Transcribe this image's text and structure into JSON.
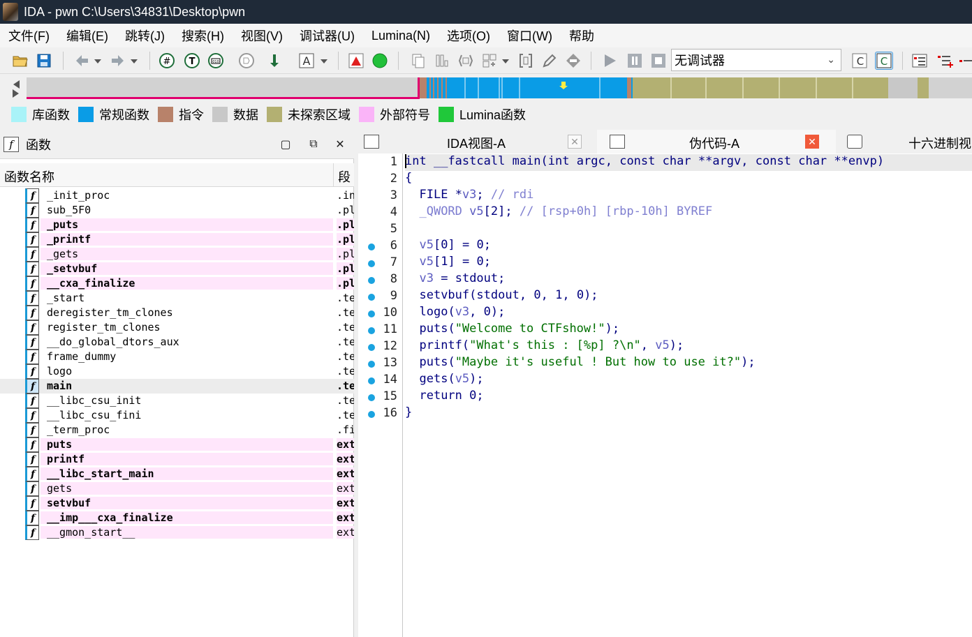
{
  "window": {
    "title": "IDA - pwn C:\\Users\\34831\\Desktop\\pwn"
  },
  "menu": [
    "文件(F)",
    "编辑(E)",
    "跳转(J)",
    "搜索(H)",
    "视图(V)",
    "调试器(U)",
    "Lumina(N)",
    "选项(O)",
    "窗口(W)",
    "帮助"
  ],
  "toolbar": {
    "debugger_select": "无调试器"
  },
  "legend": [
    {
      "label": "库函数",
      "color": "#a9f3f8"
    },
    {
      "label": "常规函数",
      "color": "#0a9ce6"
    },
    {
      "label": "指令",
      "color": "#b8826a"
    },
    {
      "label": "数据",
      "color": "#c8c8c8"
    },
    {
      "label": "未探索区域",
      "color": "#b3b072"
    },
    {
      "label": "外部符号",
      "color": "#fab4f8"
    },
    {
      "label": "Lumina函数",
      "color": "#20c83a"
    }
  ],
  "functions_panel": {
    "title": "函数",
    "col_name": "函数名称",
    "col_segment": "段",
    "rows": [
      {
        "name": "_init_proc",
        "segment": ".init",
        "bold": false,
        "pink": false
      },
      {
        "name": "sub_5F0",
        "segment": ".plt",
        "bold": false,
        "pink": false
      },
      {
        "name": "_puts",
        "segment": ".plt",
        "bold": true,
        "pink": true
      },
      {
        "name": "_printf",
        "segment": ".plt",
        "bold": true,
        "pink": true
      },
      {
        "name": "_gets",
        "segment": ".plt",
        "bold": false,
        "pink": true
      },
      {
        "name": "_setvbuf",
        "segment": ".plt",
        "bold": true,
        "pink": true
      },
      {
        "name": "__cxa_finalize",
        "segment": ".plt",
        "bold": true,
        "pink": true
      },
      {
        "name": "_start",
        "segment": ".text",
        "bold": false,
        "pink": false
      },
      {
        "name": "deregister_tm_clones",
        "segment": ".text",
        "bold": false,
        "pink": false
      },
      {
        "name": "register_tm_clones",
        "segment": ".text",
        "bold": false,
        "pink": false
      },
      {
        "name": "__do_global_dtors_aux",
        "segment": ".text",
        "bold": false,
        "pink": false
      },
      {
        "name": "frame_dummy",
        "segment": ".text",
        "bold": false,
        "pink": false
      },
      {
        "name": "logo",
        "segment": ".text",
        "bold": false,
        "pink": false
      },
      {
        "name": "main",
        "segment": ".text",
        "bold": true,
        "pink": false,
        "selected": true
      },
      {
        "name": "__libc_csu_init",
        "segment": ".text",
        "bold": false,
        "pink": false
      },
      {
        "name": "__libc_csu_fini",
        "segment": ".text",
        "bold": false,
        "pink": false
      },
      {
        "name": "_term_proc",
        "segment": ".fini",
        "bold": false,
        "pink": false
      },
      {
        "name": "puts",
        "segment": "extern",
        "bold": true,
        "pink": true
      },
      {
        "name": "printf",
        "segment": "extern",
        "bold": true,
        "pink": true
      },
      {
        "name": "__libc_start_main",
        "segment": "extern",
        "bold": true,
        "pink": true
      },
      {
        "name": "gets",
        "segment": "extern",
        "bold": false,
        "pink": true
      },
      {
        "name": "setvbuf",
        "segment": "extern",
        "bold": true,
        "pink": true
      },
      {
        "name": "__imp___cxa_finalize",
        "segment": "extern",
        "bold": true,
        "pink": true
      },
      {
        "name": "__gmon_start__",
        "segment": "extern",
        "bold": false,
        "pink": true
      }
    ]
  },
  "tabs": [
    {
      "label": "IDA视图-A"
    },
    {
      "label": "伪代码-A"
    },
    {
      "label": "十六进制视"
    }
  ],
  "code": {
    "lines": [
      {
        "n": "1",
        "dot": false,
        "text": "int __fastcall main(int argc, const char **argv, const char **envp)"
      },
      {
        "n": "2",
        "dot": false,
        "text": "{"
      },
      {
        "n": "3",
        "dot": false,
        "text": "  FILE *v3; // rdi"
      },
      {
        "n": "4",
        "dot": false,
        "text": "  _QWORD v5[2]; // [rsp+0h] [rbp-10h] BYREF"
      },
      {
        "n": "5",
        "dot": false,
        "text": ""
      },
      {
        "n": "6",
        "dot": true,
        "text": "  v5[0] = 0;"
      },
      {
        "n": "7",
        "dot": true,
        "text": "  v5[1] = 0;"
      },
      {
        "n": "8",
        "dot": true,
        "text": "  v3 = stdout;"
      },
      {
        "n": "9",
        "dot": true,
        "text": "  setvbuf(stdout, 0, 1, 0);"
      },
      {
        "n": "10",
        "dot": true,
        "text": "  logo(v3, 0);"
      },
      {
        "n": "11",
        "dot": true,
        "text": "  puts(\"Welcome to CTFshow!\");"
      },
      {
        "n": "12",
        "dot": true,
        "text": "  printf(\"What's this : [%p] ?\\n\", v5);"
      },
      {
        "n": "13",
        "dot": true,
        "text": "  puts(\"Maybe it's useful ! But how to use it?\");"
      },
      {
        "n": "14",
        "dot": true,
        "text": "  gets(v5);"
      },
      {
        "n": "15",
        "dot": true,
        "text": "  return 0;"
      },
      {
        "n": "16",
        "dot": true,
        "text": "}"
      }
    ]
  }
}
